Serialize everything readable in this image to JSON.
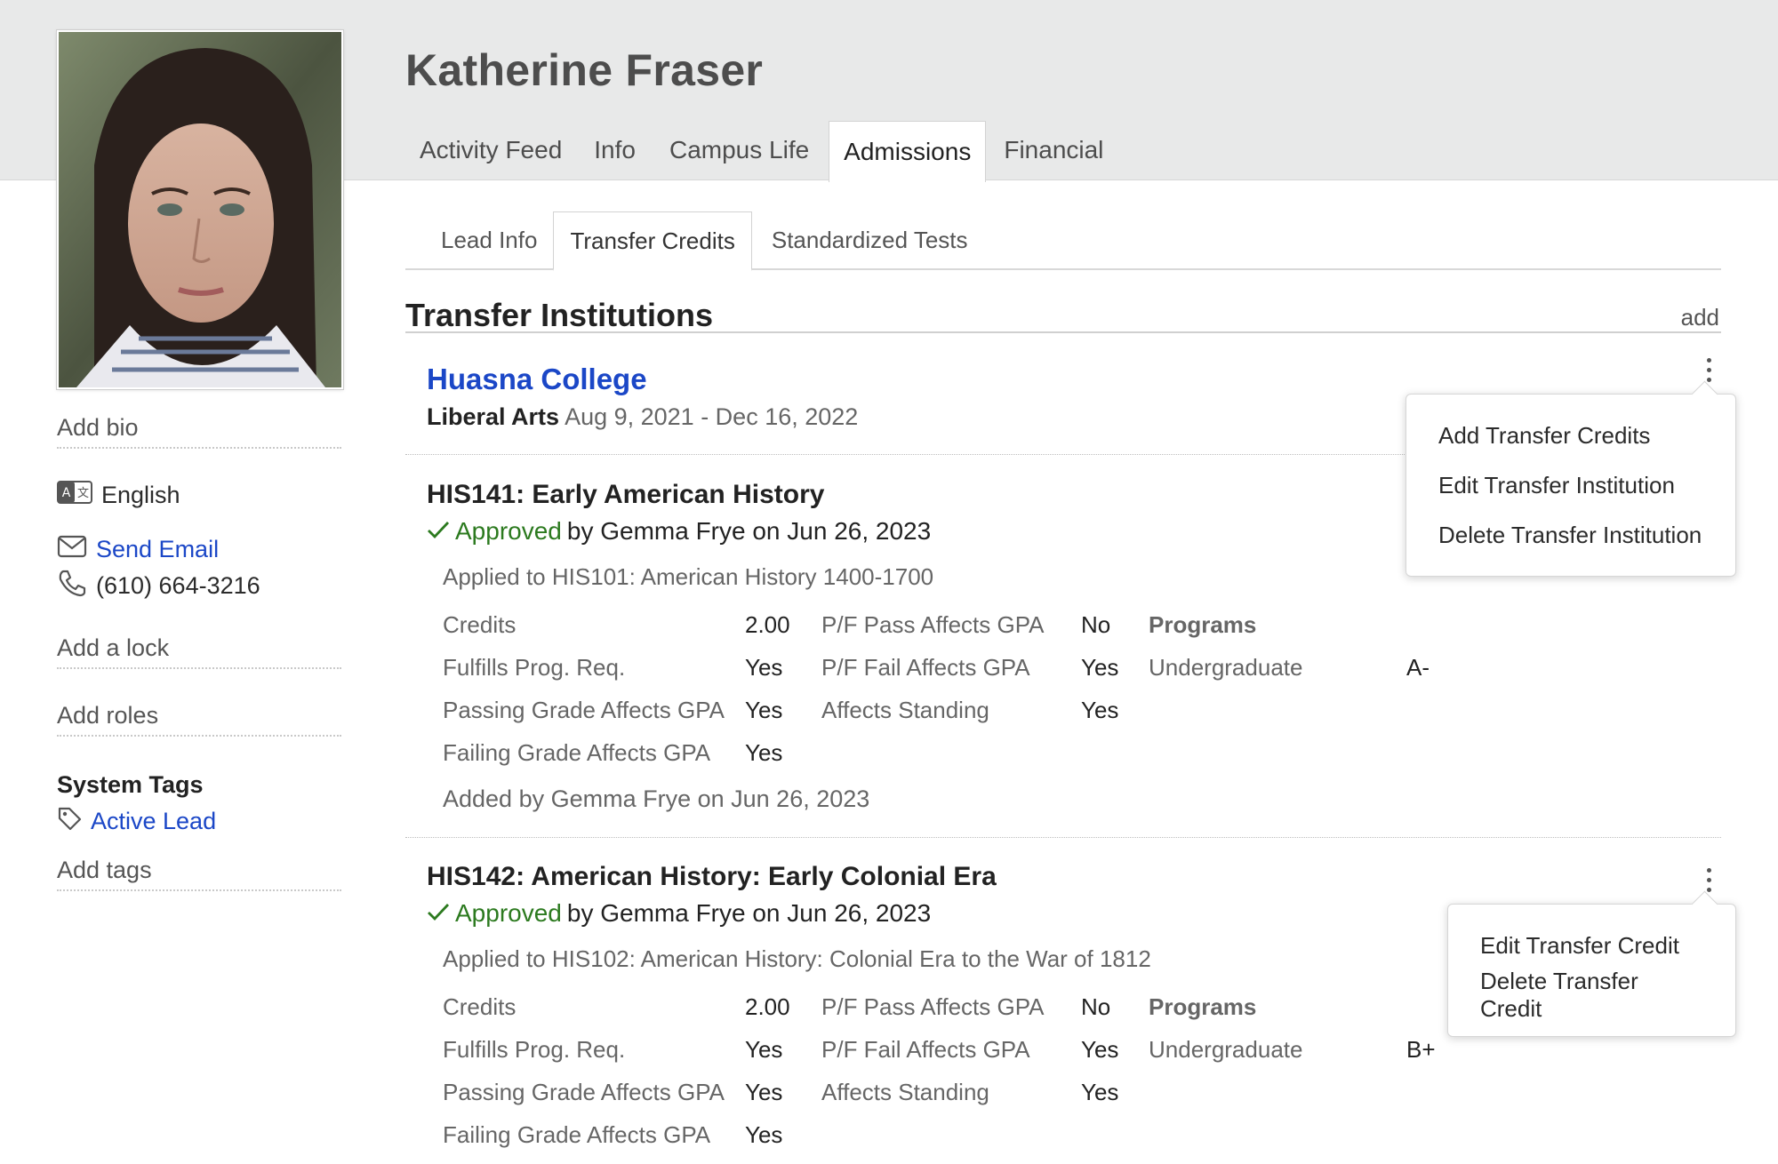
{
  "profile": {
    "name": "Katherine Fraser",
    "add_bio": "Add bio",
    "language": "English",
    "send_email": "Send Email",
    "phone": "(610) 664-3216",
    "add_lock": "Add a lock",
    "add_roles": "Add roles",
    "system_tags_title": "System Tags",
    "tag": "Active Lead",
    "add_tags": "Add tags"
  },
  "tabs": [
    "Activity Feed",
    "Info",
    "Campus Life",
    "Admissions",
    "Financial"
  ],
  "active_tab": "Admissions",
  "subtabs": [
    "Lead Info",
    "Transfer Credits",
    "Standardized Tests"
  ],
  "active_subtab": "Transfer Credits",
  "section": {
    "title": "Transfer Institutions",
    "add": "add"
  },
  "institution": {
    "name": "Huasna College",
    "program": "Liberal Arts",
    "dates": "Aug 9, 2021 - Dec 16, 2022"
  },
  "institution_menu": [
    "Add Transfer Credits",
    "Edit Transfer Institution",
    "Delete Transfer Institution"
  ],
  "credit_menu": [
    "Edit Transfer Credit",
    "Delete Transfer Credit"
  ],
  "labels": {
    "credits": "Credits",
    "fulfills": "Fulfills Prog. Req.",
    "passing": "Passing Grade Affects GPA",
    "failing": "Failing Grade Affects GPA",
    "pf_pass": "P/F Pass Affects GPA",
    "pf_fail": "P/F Fail Affects GPA",
    "standing": "Affects Standing",
    "programs": "Programs",
    "applied_to": "Applied to",
    "approved": "Approved"
  },
  "courses": [
    {
      "title": "HIS141: Early American History",
      "approved_by": "by Gemma Frye on Jun 26, 2023",
      "applied": "HIS101: American History 1400-1700",
      "credits": "2.00",
      "fulfills": "Yes",
      "passing": "Yes",
      "failing": "Yes",
      "pf_pass": "No",
      "pf_fail": "Yes",
      "standing": "Yes",
      "program": "Undergraduate",
      "grade": "A-",
      "added_by": "Added by Gemma Frye on Jun 26, 2023"
    },
    {
      "title": "HIS142: American History: Early Colonial Era",
      "approved_by": "by Gemma Frye on Jun 26, 2023",
      "applied": "HIS102: American History: Colonial Era to the War of 1812",
      "credits": "2.00",
      "fulfills": "Yes",
      "passing": "Yes",
      "failing": "Yes",
      "pf_pass": "No",
      "pf_fail": "Yes",
      "standing": "Yes",
      "program": "Undergraduate",
      "grade": "B+"
    }
  ]
}
